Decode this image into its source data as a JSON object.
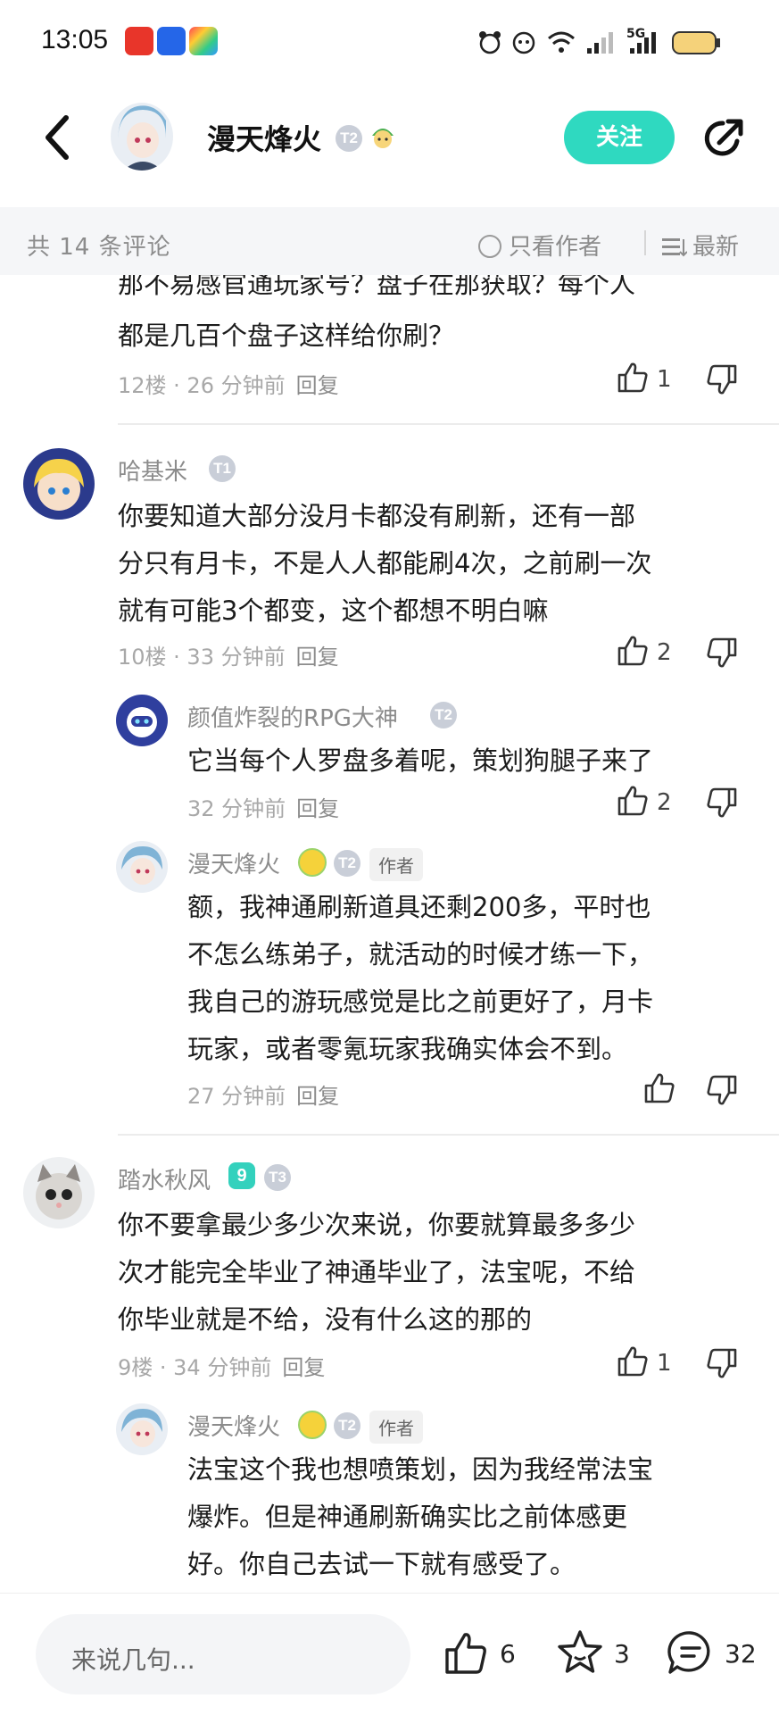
{
  "status": {
    "time": "13:05",
    "network": "5G"
  },
  "header": {
    "author_name": "漫天烽火",
    "badge": "T2",
    "follow_label": "关注"
  },
  "filter": {
    "count_text": "共 14 条评论",
    "author_only": "只看作者",
    "sort": "最新"
  },
  "comments": [
    {
      "partial_line": "那不易感官通玩家号？盘子在那获取？每个人",
      "text_lines": [
        "都是几百个盘子这样给你刷？"
      ],
      "meta": "12楼 · 26 分钟前",
      "reply": "回复",
      "likes": "1"
    },
    {
      "user": "哈基米",
      "badge": "T1",
      "text_lines": [
        "你要知道大部分没月卡都没有刷新，还有一部",
        "分只有月卡，不是人人都能刷4次，之前刷一次",
        "就有可能3个都变，这个都想不明白嘛"
      ],
      "meta": "10楼 · 33 分钟前",
      "reply": "回复",
      "likes": "2",
      "replies": [
        {
          "user": "颜值炸裂的RPG大神",
          "badge": "T2",
          "text_lines": [
            "它当每个人罗盘多着呢，策划狗腿子来了"
          ],
          "meta": "32 分钟前",
          "reply": "回复",
          "likes": "2"
        },
        {
          "user": "漫天烽火",
          "badge": "T2",
          "author_tag": "作者",
          "text_lines": [
            "额，我神通刷新道具还剩200多，平时也",
            "不怎么练弟子，就活动的时候才练一下，",
            "我自己的游玩感觉是比之前更好了，月卡",
            "玩家，或者零氪玩家我确实体会不到。"
          ],
          "meta": "27 分钟前",
          "reply": "回复",
          "likes": ""
        }
      ]
    },
    {
      "user": "踏水秋风",
      "level": "9",
      "badge": "T3",
      "text_lines": [
        "你不要拿最少多少次来说，你要就算最多多少",
        "次才能完全毕业了神通毕业了，法宝呢，不给",
        "你毕业就是不给，没有什么这的那的"
      ],
      "meta": "9楼 · 34 分钟前",
      "reply": "回复",
      "likes": "1",
      "replies": [
        {
          "user": "漫天烽火",
          "badge": "T2",
          "author_tag": "作者",
          "text_lines": [
            "法宝这个我也想喷策划，因为我经常法宝",
            "爆炸。但是神通刷新确实比之前体感更",
            "好。你自己去试一下就有感受了。"
          ]
        }
      ]
    }
  ],
  "bottom": {
    "placeholder": "来说几句...",
    "likes": "6",
    "favorites": "3",
    "comments": "32"
  },
  "colors": {
    "accent": "#2fd9c0",
    "text": "#1c1c1c",
    "muted": "#a8a8a8"
  }
}
